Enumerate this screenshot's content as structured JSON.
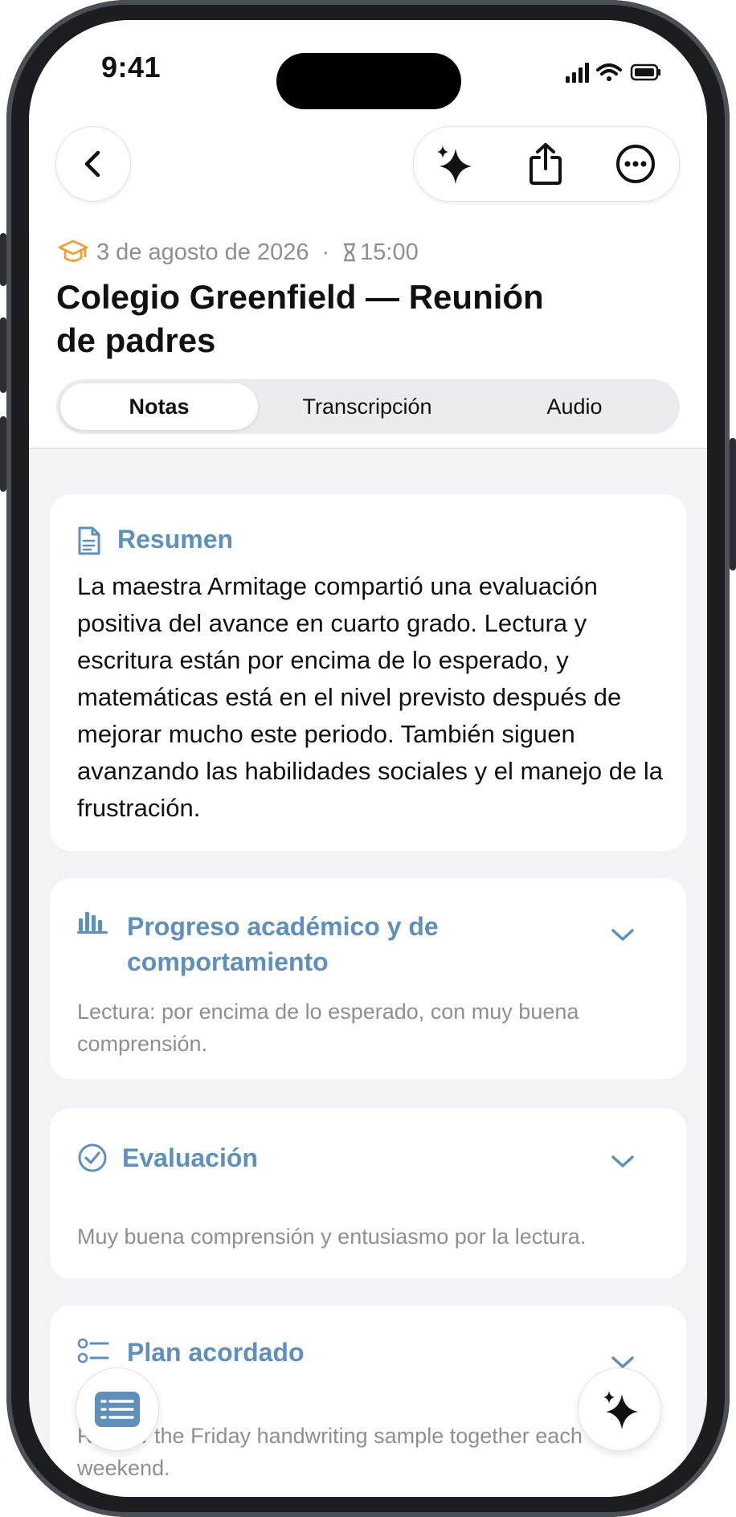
{
  "status_bar": {
    "time": "9:41"
  },
  "meta": {
    "date": "3 de agosto de 2026",
    "separator": "·",
    "duration": "15:00"
  },
  "title": "Colegio Greenfield — Reunión de padres",
  "tabs": [
    {
      "label": "Notas",
      "active": true
    },
    {
      "label": "Transcripción",
      "active": false
    },
    {
      "label": "Audio",
      "active": false
    }
  ],
  "summary": {
    "title": "Resumen",
    "text": "La maestra Armitage compartió una evaluación positiva del avance en cuarto grado. Lectura y escritura están por encima de lo esperado, y matemáticas está en el nivel previsto después de mejorar mucho este periodo. También siguen avanzando las habilidades sociales y el manejo de la frustración."
  },
  "sections": [
    {
      "title": "Progreso académico y de comportamiento",
      "preview": "Lectura: por encima de lo esperado, con muy buena comprensión.",
      "icon": "chart-bar-icon"
    },
    {
      "title": "Evaluación",
      "preview": "Muy buena comprensión y entusiasmo por la lectura.",
      "icon": "checkmark-circle-icon"
    },
    {
      "title": "Plan acordado",
      "preview": "Review the Friday handwriting sample together each weekend.",
      "icon": "checklist-icon"
    }
  ],
  "colors": {
    "accent": "#5f8fbb",
    "meta_icon": "#f0a030",
    "screen_bg": "#f2f2f7"
  }
}
